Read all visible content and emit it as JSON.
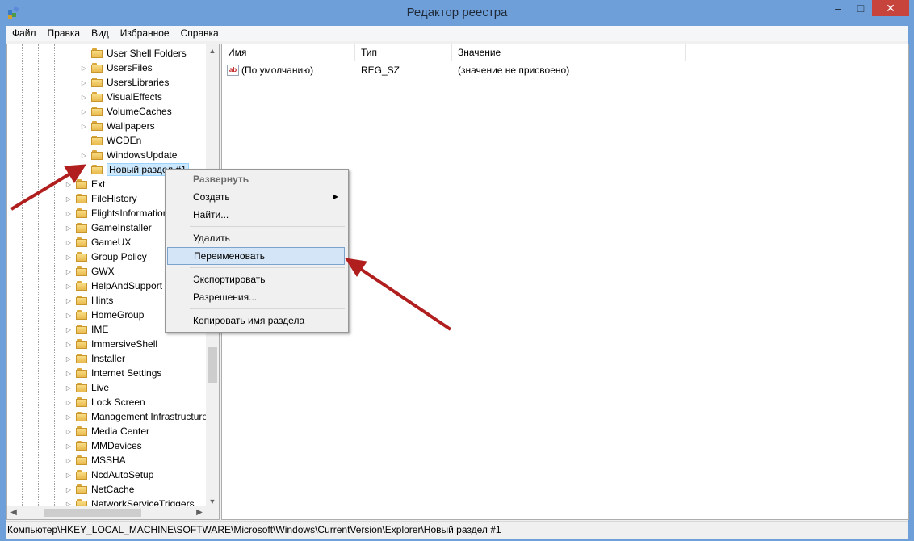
{
  "window": {
    "title": "Редактор реестра",
    "min_glyph": "–",
    "max_glyph": "□",
    "close_glyph": "✕"
  },
  "menu": [
    "Файл",
    "Правка",
    "Вид",
    "Избранное",
    "Справка"
  ],
  "tree": {
    "rows": [
      {
        "label": "User Shell Folders",
        "level": 2,
        "expander": ""
      },
      {
        "label": "UsersFiles",
        "level": 2,
        "expander": "▷"
      },
      {
        "label": "UsersLibraries",
        "level": 2,
        "expander": "▷"
      },
      {
        "label": "VisualEffects",
        "level": 2,
        "expander": "▷"
      },
      {
        "label": "VolumeCaches",
        "level": 2,
        "expander": "▷"
      },
      {
        "label": "Wallpapers",
        "level": 2,
        "expander": "▷"
      },
      {
        "label": "WCDEn",
        "level": 2,
        "expander": ""
      },
      {
        "label": "WindowsUpdate",
        "level": 2,
        "expander": "▷"
      },
      {
        "label": "Новый раздел #1",
        "level": 2,
        "expander": "",
        "selected": true
      },
      {
        "label": "Ext",
        "level": 1,
        "expander": "▷"
      },
      {
        "label": "FileHistory",
        "level": 1,
        "expander": "▷"
      },
      {
        "label": "FlightsInformation",
        "level": 1,
        "expander": "▷"
      },
      {
        "label": "GameInstaller",
        "level": 1,
        "expander": "▷"
      },
      {
        "label": "GameUX",
        "level": 1,
        "expander": "▷"
      },
      {
        "label": "Group Policy",
        "level": 1,
        "expander": "▷"
      },
      {
        "label": "GWX",
        "level": 1,
        "expander": "▷"
      },
      {
        "label": "HelpAndSupport",
        "level": 1,
        "expander": "▷"
      },
      {
        "label": "Hints",
        "level": 1,
        "expander": "▷"
      },
      {
        "label": "HomeGroup",
        "level": 1,
        "expander": "▷"
      },
      {
        "label": "IME",
        "level": 1,
        "expander": "▷"
      },
      {
        "label": "ImmersiveShell",
        "level": 1,
        "expander": "▷"
      },
      {
        "label": "Installer",
        "level": 1,
        "expander": "▷"
      },
      {
        "label": "Internet Settings",
        "level": 1,
        "expander": "▷"
      },
      {
        "label": "Live",
        "level": 1,
        "expander": "▷"
      },
      {
        "label": "Lock Screen",
        "level": 1,
        "expander": "▷"
      },
      {
        "label": "Management Infrastructure",
        "level": 1,
        "expander": "▷"
      },
      {
        "label": "Media Center",
        "level": 1,
        "expander": "▷"
      },
      {
        "label": "MMDevices",
        "level": 1,
        "expander": "▷"
      },
      {
        "label": "MSSHA",
        "level": 1,
        "expander": "▷"
      },
      {
        "label": "NcdAutoSetup",
        "level": 1,
        "expander": "▷"
      },
      {
        "label": "NetCache",
        "level": 1,
        "expander": "▷"
      },
      {
        "label": "NetworkServiceTriggers",
        "level": 1,
        "expander": "▷"
      }
    ],
    "scroll_up": "▲",
    "scroll_down": "▼",
    "scroll_left": "◀",
    "scroll_right": "▶"
  },
  "list": {
    "columns": [
      "Имя",
      "Тип",
      "Значение"
    ],
    "rows": [
      {
        "name": "(По умолчанию)",
        "type": "REG_SZ",
        "value": "(значение не присвоено)",
        "icon": "ab"
      }
    ]
  },
  "context_menu": {
    "items": [
      {
        "label": "Развернуть",
        "style": "bold"
      },
      {
        "label": "Создать",
        "submenu": "▶"
      },
      {
        "label": "Найти..."
      },
      {
        "label": "Удалить"
      },
      {
        "label": "Переименовать",
        "highlighted": true
      },
      {
        "label": "Экспортировать"
      },
      {
        "label": "Разрешения..."
      },
      {
        "label": "Копировать имя раздела"
      }
    ]
  },
  "status": "Компьютер\\HKEY_LOCAL_MACHINE\\SOFTWARE\\Microsoft\\Windows\\CurrentVersion\\Explorer\\Новый раздел #1",
  "colors": {
    "titlebar": "#6f9fd8",
    "close": "#c7443d",
    "arrow": "#b01e1e",
    "highlight": "#d4e5f7"
  }
}
